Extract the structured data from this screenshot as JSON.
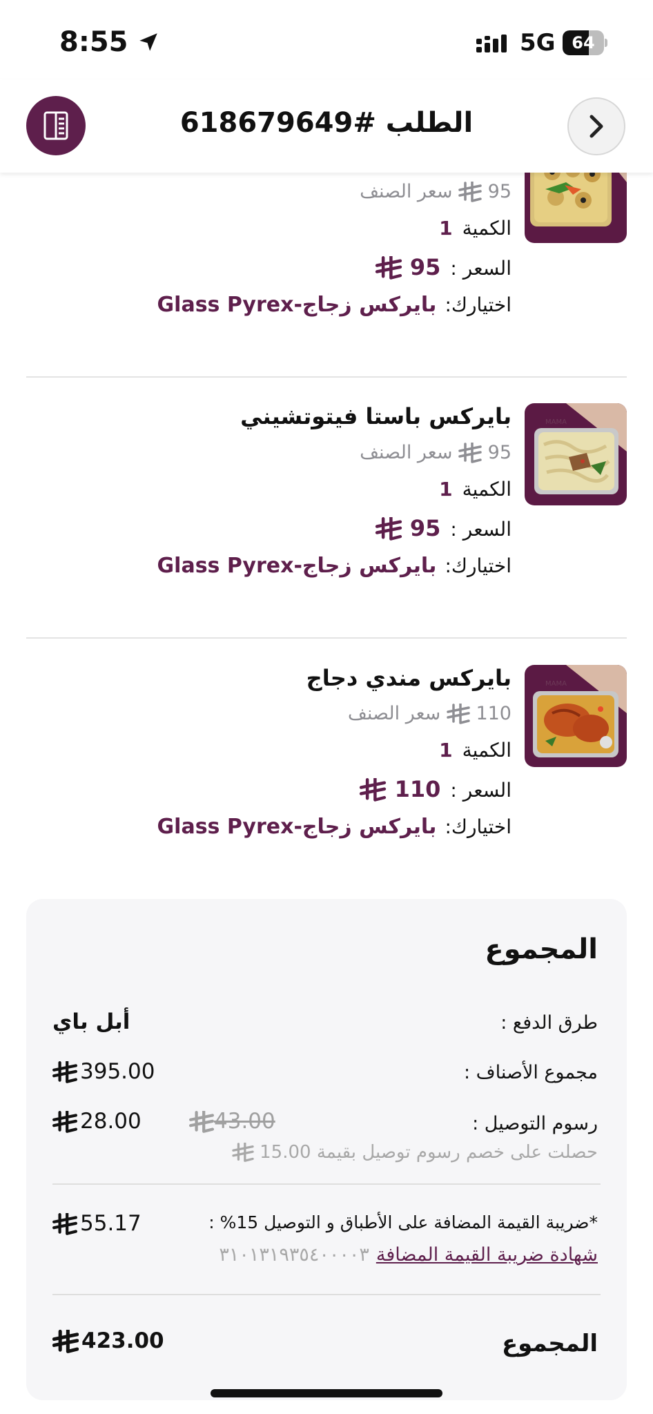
{
  "status_bar": {
    "time": "8:55",
    "network": "5G",
    "battery_level": "64",
    "battery_fraction": 0.64
  },
  "header": {
    "title": "الطلب #618679649",
    "menu_icon": "receipt-icon",
    "back_icon": "chevron-right-icon"
  },
  "items": [
    {
      "name": "",
      "unit_price": "95",
      "unit_price_label": "سعر الصنف",
      "quantity_label": "الكمية",
      "quantity": "1",
      "price_label": "السعر :",
      "price": "95",
      "option_label": "اختيارك:",
      "option": "بايركس زجاج-Glass Pyrex"
    },
    {
      "name": "بايركس باستا فيتوتشيني",
      "unit_price": "95",
      "unit_price_label": "سعر الصنف",
      "quantity_label": "الكمية",
      "quantity": "1",
      "price_label": "السعر :",
      "price": "95",
      "option_label": "اختيارك:",
      "option": "بايركس زجاج-Glass Pyrex"
    },
    {
      "name": "بايركس مندي دجاج",
      "unit_price": "110",
      "unit_price_label": "سعر الصنف",
      "quantity_label": "الكمية",
      "quantity": "1",
      "price_label": "السعر :",
      "price": "110",
      "option_label": "اختيارك:",
      "option": "بايركس زجاج-Glass Pyrex"
    }
  ],
  "summary": {
    "title": "المجموع",
    "payment_label": "طرق الدفع :",
    "payment_value": "أبل باي",
    "items_total_label": "مجموع الأصناف :",
    "items_total": "395.00",
    "delivery_label": "رسوم التوصيل :",
    "delivery_fee": "28.00",
    "delivery_original": "43.00",
    "delivery_discount_note": "حصلت على خصم رسوم توصيل بقيمة 15.00",
    "vat_label": "*ضريبة القيمة المضافة على الأطباق و التوصيل 15% :",
    "vat_value": "55.17",
    "vat_certificate_link": "شهادة ضريبة القيمة المضافة",
    "vat_number": "٣١٠١٣١٩٣٥٤٠٠٠٠٣",
    "total_label": "المجموع",
    "total": "423.00"
  },
  "colors": {
    "accent": "#5e1f4c",
    "muted": "#8e8e93",
    "card_bg": "#f6f6f8"
  }
}
